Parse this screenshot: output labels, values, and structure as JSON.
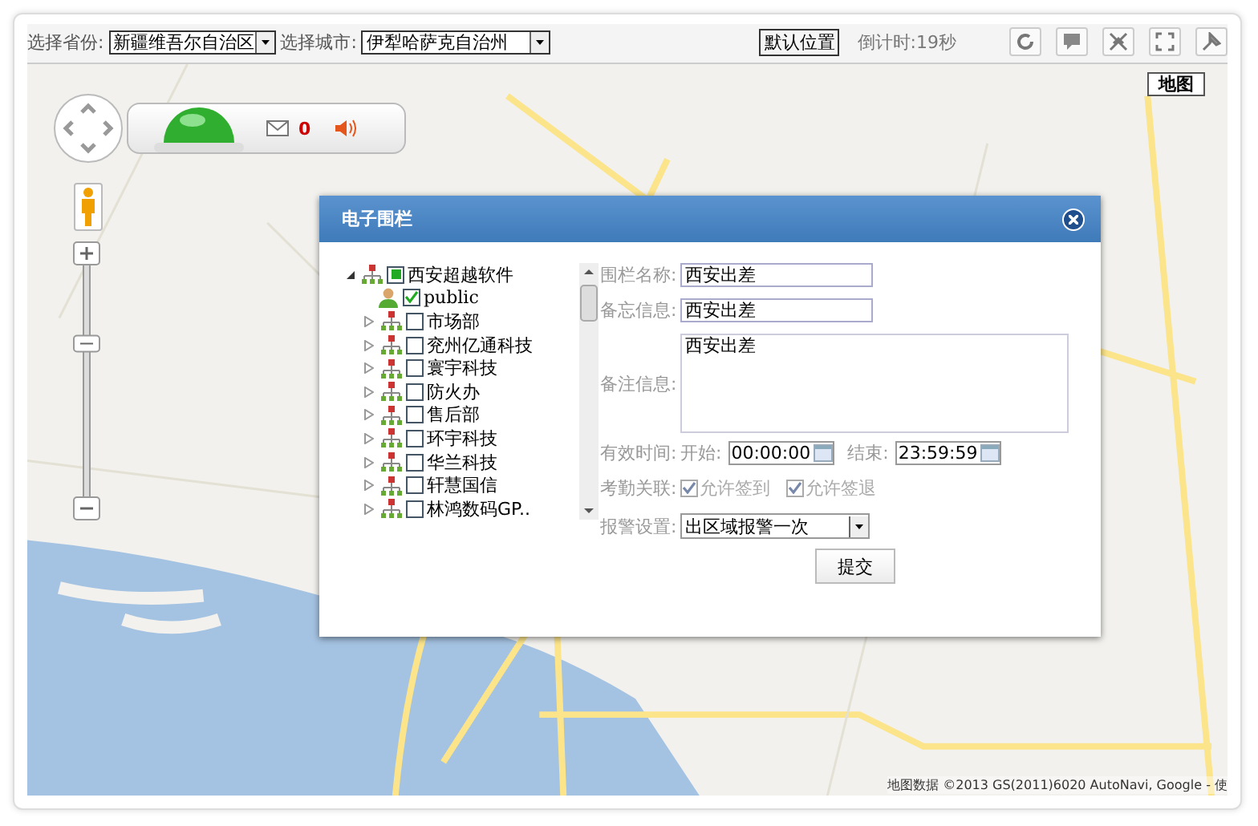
{
  "toolbar": {
    "province_label": "选择省份:",
    "province": "新疆维吾尔自治区",
    "city_label": "选择城市:",
    "city": "伊犁哈萨克自治州",
    "default_button": "默认位置",
    "countdown": "倒计时:19秒"
  },
  "map": {
    "kind": "picture",
    "zoom": {
      "level": 0.63
    },
    "alarm_count": "0",
    "map_type_button": "地图",
    "attribution": "地图数据 ©2013 GS(2011)6020 AutoNavi, Google - 使"
  },
  "dialog": {
    "title": "电子围栏",
    "tree": {
      "label": "西安超越软件",
      "expanded": true,
      "partial": true,
      "children": [
        {
          "kind": "user",
          "label": "public",
          "checked": true
        },
        {
          "kind": "group",
          "label": "市场部",
          "checked": false,
          "expanded": false
        },
        {
          "kind": "group",
          "label": "兖州亿通科技",
          "checked": false,
          "expanded": false
        },
        {
          "kind": "group",
          "label": "寰宇科技",
          "checked": false,
          "expanded": false
        },
        {
          "kind": "group",
          "label": "防火办",
          "checked": false,
          "expanded": false
        },
        {
          "kind": "group",
          "label": "售后部",
          "checked": false,
          "expanded": false
        },
        {
          "kind": "group",
          "label": "环宇科技",
          "checked": false,
          "expanded": false
        },
        {
          "kind": "group",
          "label": "华兰科技",
          "checked": false,
          "expanded": false
        },
        {
          "kind": "group",
          "label": "轩慧国信",
          "checked": false,
          "expanded": false
        },
        {
          "kind": "group",
          "label": "林鸿数码GP..",
          "checked": false,
          "expanded": false
        }
      ]
    },
    "fields": [
      {
        "kind": "text",
        "label": "围栏名称:",
        "value": "西安出差"
      },
      {
        "kind": "text",
        "label": "备忘信息:",
        "value": "西安出差"
      },
      {
        "kind": "textarea",
        "label": "备注信息:",
        "value": "西安出差"
      }
    ],
    "time": {
      "label": "有效时间:",
      "start_label": "开始:",
      "start": "00:00:00",
      "end_label": "结束:",
      "end": "23:59:59"
    },
    "attendance": {
      "label": "考勤关联:",
      "options": [
        {
          "label": "允许签到",
          "checked": true,
          "disabled": true
        },
        {
          "label": "允许签退",
          "checked": true,
          "disabled": true
        }
      ]
    },
    "alarm": {
      "label": "报警设置:",
      "value": "出区域报警一次"
    },
    "submit": "提交"
  }
}
